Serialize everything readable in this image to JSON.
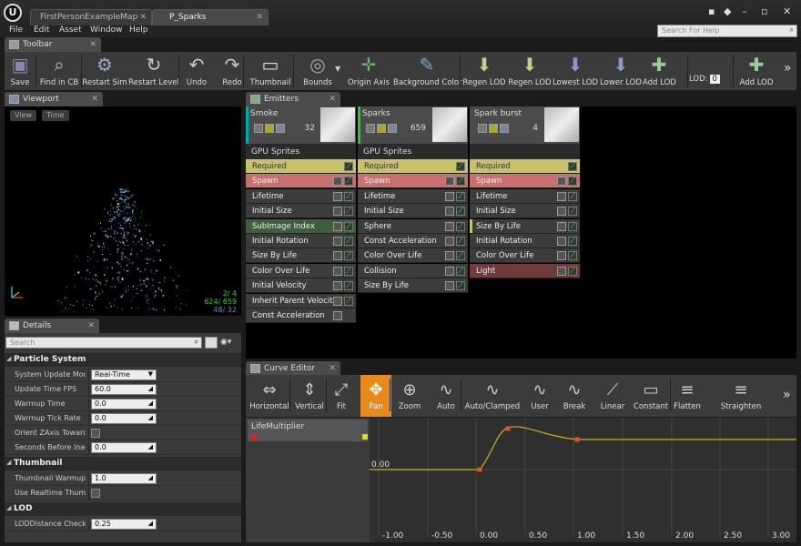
{
  "window": {
    "tabs": [
      {
        "label": "FirstPersonExampleMap"
      },
      {
        "label": "P_Sparks"
      }
    ]
  },
  "menu": {
    "items": [
      "File",
      "Edit",
      "Asset",
      "Window",
      "Help"
    ],
    "search_placeholder": "Search For Help"
  },
  "toolbar": {
    "tab_label": "Toolbar",
    "buttons": [
      "Save",
      "Find in CB",
      "Restart Sim",
      "Restart Level",
      "Undo",
      "Redo",
      "Thumbnail",
      "Bounds",
      "Origin Axis",
      "Background Color",
      "Regen LOD",
      "Regen LOD",
      "Lowest LOD",
      "Lower LOD",
      "Add LOD",
      "Add LOD"
    ],
    "lod_label": "LOD:",
    "lod_value": "0"
  },
  "viewport": {
    "tab_label": "Viewport",
    "view_button": "View",
    "time_button": "Time",
    "stats": [
      "2/ 4",
      "624/ 659",
      "48/ 32"
    ]
  },
  "details": {
    "tab_label": "Details",
    "search_placeholder": "Search",
    "sections": [
      {
        "title": "Particle System",
        "rows": [
          {
            "label": "System Update Mode",
            "value": "Real-Time",
            "kind": "dropdown"
          },
          {
            "label": "Update Time FPS",
            "value": "60.0",
            "kind": "number"
          },
          {
            "label": "Warmup Time",
            "value": "0.0",
            "kind": "number"
          },
          {
            "label": "Warmup Tick Rate",
            "value": "0.0",
            "kind": "number"
          },
          {
            "label": "Orient ZAxis Toward Camera",
            "value": "",
            "kind": "check"
          },
          {
            "label": "Seconds Before Inactive",
            "value": "0.0",
            "kind": "number"
          }
        ]
      },
      {
        "title": "Thumbnail",
        "rows": [
          {
            "label": "Thumbnail Warmup",
            "value": "1.0",
            "kind": "number"
          },
          {
            "label": "Use Realtime Thumbnail",
            "value": "",
            "kind": "check"
          }
        ]
      },
      {
        "title": "LOD",
        "rows": [
          {
            "label": "LODDistance Check Time",
            "value": "0.25",
            "kind": "number"
          }
        ]
      }
    ]
  },
  "emitters": {
    "tab_label": "Emitters",
    "columns": [
      {
        "name": "Smoke",
        "count": "32",
        "type": "GPU Sprites",
        "modules": [
          "Required",
          "Spawn",
          "Lifetime",
          "Initial Size",
          "SubImage Index",
          "Initial Rotation",
          "Size By Life",
          "Color Over Life",
          "Initial Velocity",
          "Inherit Parent Velocity",
          "Const Acceleration"
        ]
      },
      {
        "name": "Sparks",
        "count": "659",
        "type": "GPU Sprites",
        "modules": [
          "Required",
          "Spawn",
          "Lifetime",
          "Initial Size",
          "Sphere",
          "Const Acceleration",
          "Color Over Life",
          "Collision",
          "Size By Life"
        ]
      },
      {
        "name": "Spark burst",
        "count": "4",
        "type": "",
        "modules": [
          "Required",
          "Spawn",
          "Lifetime",
          "Initial Size",
          "Size By Life",
          "Initial Rotation",
          "Color Over Life",
          "Light"
        ]
      }
    ]
  },
  "curve_editor": {
    "tab_label": "Curve Editor",
    "buttons": [
      "Horizontal",
      "Vertical",
      "Fit",
      "Pan",
      "Zoom",
      "Auto",
      "Auto/Clamped",
      "User",
      "Break",
      "Linear",
      "Constant",
      "Flatten",
      "Straighten"
    ],
    "track_name": "LifeMultiplier",
    "y_label": "0.00",
    "x_ticks": [
      "-1.00",
      "-0.50",
      "0.00",
      "0.50",
      "1.00",
      "1.50",
      "2.00",
      "2.50",
      "3.00"
    ]
  },
  "colors": {
    "accent": "#e8891c",
    "required": "#c7c16a",
    "spawn": "#c9706f",
    "curve": "#c8b41e"
  }
}
